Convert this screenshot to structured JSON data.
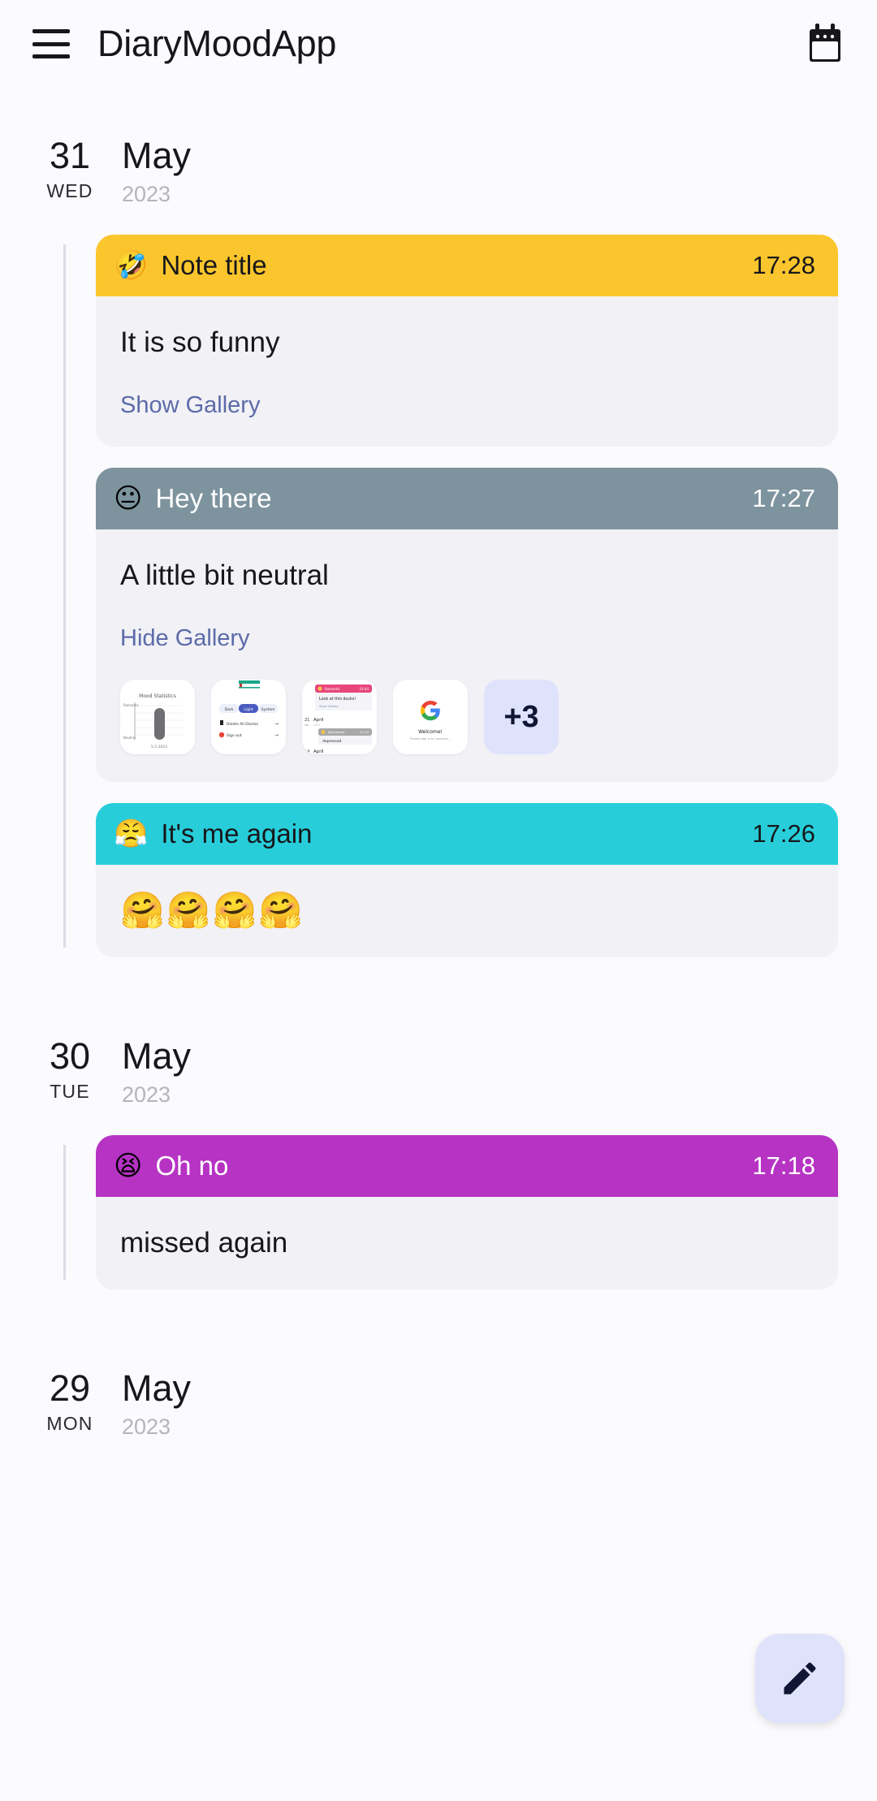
{
  "app": {
    "title": "DiaryMoodApp",
    "menu_icon": "hamburger-menu-icon",
    "calendar_icon": "calendar-icon",
    "background_color": "#FBFAFD"
  },
  "fab": {
    "icon": "pencil-edit-icon",
    "background_color": "#DFE2FB",
    "icon_color": "#121635"
  },
  "days": [
    {
      "day_number": "31",
      "weekday": "WED",
      "month": "May",
      "year": "2023",
      "notes": [
        {
          "emoji": "🤣",
          "emoji_name": "rolling-on-the-floor-laughing",
          "title": "Note title",
          "time": "17:28",
          "header_color": "#FBC62D",
          "header_text_color": "#17171B",
          "body": "It is so funny",
          "gallery_label": "Show Gallery",
          "gallery_open": false,
          "thumbs": [],
          "more_count": ""
        },
        {
          "emoji": "😐",
          "emoji_name": "neutral-face",
          "title": "Hey there",
          "time": "17:27",
          "header_color": "#7D939E",
          "header_text_color": "#FFFFFF",
          "body": "A little bit neutral",
          "gallery_label": "Hide Gallery",
          "gallery_open": true,
          "thumbs": [
            {
              "name": "mood-statistics-chart-screenshot",
              "kind": "chart"
            },
            {
              "name": "settings-theme-screenshot",
              "kind": "settings"
            },
            {
              "name": "diary-list-screenshot",
              "kind": "diary"
            },
            {
              "name": "google-signin-welcome-screenshot",
              "kind": "google"
            }
          ],
          "more_count": "+3"
        },
        {
          "emoji": "😤",
          "emoji_name": "face-with-steam-from-nose",
          "title": "It's me again",
          "time": "17:26",
          "header_color": "#27CEDA",
          "header_text_color": "#17171B",
          "body": "🤗🤗🤗🤗",
          "body_is_emoji": true,
          "gallery_label": "",
          "gallery_open": false,
          "thumbs": [],
          "more_count": ""
        }
      ]
    },
    {
      "day_number": "30",
      "weekday": "TUE",
      "month": "May",
      "year": "2023",
      "notes": [
        {
          "emoji": "😫",
          "emoji_name": "tired-face",
          "title": "Oh no",
          "time": "17:18",
          "header_color": "#B633C4",
          "header_text_color": "#FFFFFF",
          "body": "missed again",
          "gallery_label": "",
          "gallery_open": false,
          "thumbs": [],
          "more_count": ""
        }
      ]
    },
    {
      "day_number": "29",
      "weekday": "MON",
      "month": "May",
      "year": "2023",
      "notes": []
    }
  ]
}
